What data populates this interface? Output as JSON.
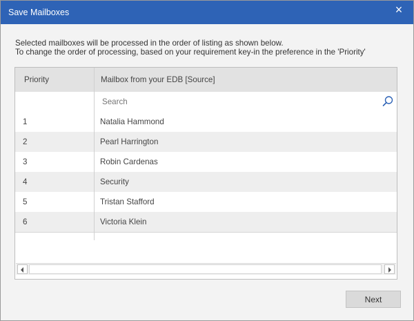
{
  "dialog": {
    "title": "Save Mailboxes",
    "close_label": "×"
  },
  "instructions": {
    "line1": "Selected mailboxes will be processed in the order of listing as shown below.",
    "line2": "To change the order of processing, based on your requirement key-in the preference in the 'Priority'"
  },
  "grid": {
    "columns": [
      "Priority",
      "Mailbox from your EDB [Source]"
    ],
    "search_placeholder": "Search",
    "rows": [
      {
        "priority": "1",
        "mailbox": "Natalia Hammond"
      },
      {
        "priority": "2",
        "mailbox": "Pearl Harrington"
      },
      {
        "priority": "3",
        "mailbox": "Robin Cardenas"
      },
      {
        "priority": "4",
        "mailbox": "Security"
      },
      {
        "priority": "5",
        "mailbox": "Tristan Stafford"
      },
      {
        "priority": "6",
        "mailbox": "Victoria Klein"
      }
    ]
  },
  "footer": {
    "next_label": "Next"
  },
  "colors": {
    "titlebar": "#2e63b6",
    "dialog_bg": "#f3f3f3",
    "row_alt": "#eeeeee"
  },
  "icons": {
    "close": "close-icon",
    "search": "search-icon",
    "scroll_left": "arrow-left-icon",
    "scroll_right": "arrow-right-icon"
  }
}
